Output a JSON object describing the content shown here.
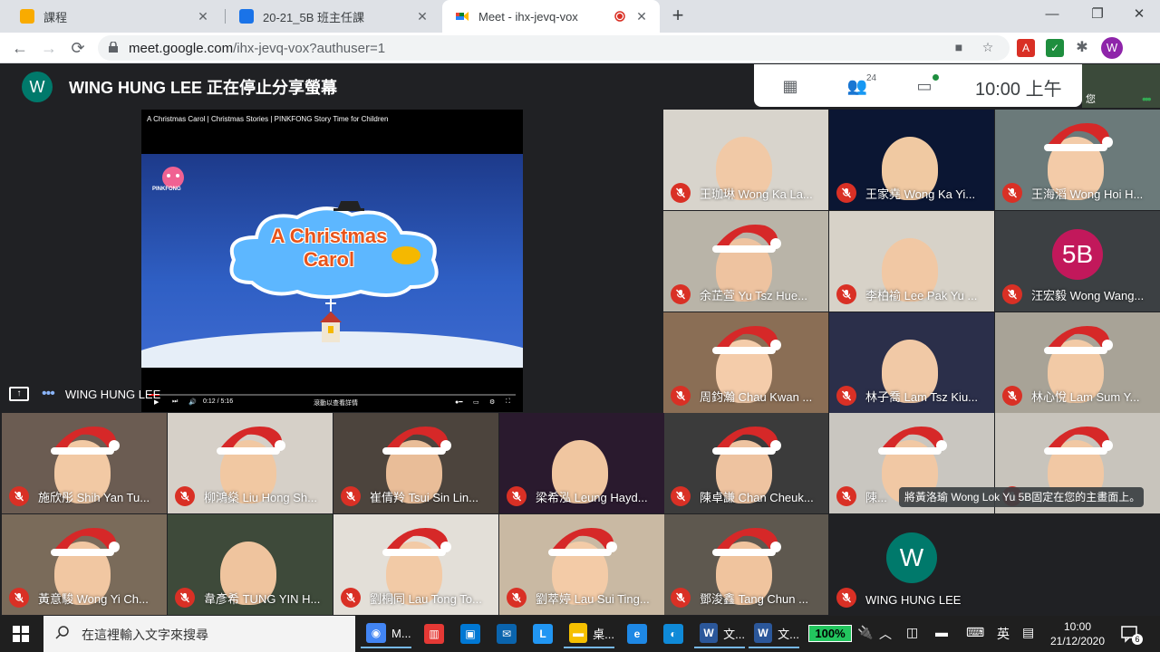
{
  "browser": {
    "tabs": [
      {
        "label": "課程",
        "color": "#f9ab00"
      },
      {
        "label": "20-21_5B 班主任課",
        "color": "#1a73e8"
      },
      {
        "label": "Meet - ihx-jevq-vox",
        "color": "#00832d"
      }
    ],
    "url_host": "meet.google.com",
    "url_path": "/ihx-jevq-vox?authuser=1",
    "profile_initial": "W"
  },
  "meet": {
    "presenter_initial": "W",
    "presenter_status": "WING HUNG LEE 正在停止分享螢幕",
    "people_count": "24",
    "clock": "10:00 上午",
    "corner_text": "您",
    "share_title": "A Christmas Carol | Christmas Stories | PINKFONG Story Time for Children",
    "video_title": "A Christmas Carol",
    "video_logo": "PINKFONG",
    "video_time": "0:12 / 5:16",
    "video_caption": "滾動以查看詳情",
    "share_name": "WING HUNG LEE",
    "pin_toast": "將黃洛瑜 Wong Lok Yu 5B固定在您的主畫面上。",
    "right_tiles": [
      {
        "name": "王珈琳 Wong Ka La..."
      },
      {
        "name": "王家堯 Wong Ka Yi..."
      },
      {
        "name": "王海滔 Wong Hoi H..."
      },
      {
        "name": "余芷萱 Yu Tsz Hue..."
      },
      {
        "name": "李柏褕 Lee Pak Yu ..."
      },
      {
        "name": "汪宏毅 Wong Wang...",
        "avatar": "5B"
      },
      {
        "name": "周鈞瀚 Chau Kwan ..."
      },
      {
        "name": "林子喬 Lam Tsz Kiu..."
      },
      {
        "name": "林心悅 Lam Sum Y..."
      },
      {
        "name": "陳卓謙 Chan Cheuk..."
      },
      {
        "name": "陳..."
      },
      {
        "name": ""
      },
      {
        "name": "鄧浚鑫 Tang Chun ..."
      },
      {
        "name": "WING HUNG LEE",
        "avatar": "W"
      }
    ],
    "bottom_tiles": [
      {
        "name": "施欣彤 Shih Yan Tu..."
      },
      {
        "name": "柳鴻燊 Liu Hong Sh..."
      },
      {
        "name": "崔倩羚 Tsui Sin Lin..."
      },
      {
        "name": "梁希泓 Leung Hayd..."
      },
      {
        "name": "黃意駿 Wong Yi Ch..."
      },
      {
        "name": "韋彥希 TUNG YIN H..."
      },
      {
        "name": "劉桐同 Lau Tong To..."
      },
      {
        "name": "劉萃婷 Lau Sui Ting..."
      }
    ]
  },
  "taskbar": {
    "search_placeholder": "在這裡輸入文字來搜尋",
    "apps": [
      {
        "label": "M...",
        "icon": "chrome-icon"
      },
      {
        "label": "",
        "icon": "app-red-icon"
      },
      {
        "label": "",
        "icon": "store-icon"
      },
      {
        "label": "",
        "icon": "mail-icon"
      },
      {
        "label": "",
        "icon": "l-app-icon"
      },
      {
        "label": "桌...",
        "icon": "folder-icon"
      },
      {
        "label": "",
        "icon": "ie-icon"
      },
      {
        "label": "",
        "icon": "edge-icon"
      },
      {
        "label": "文...",
        "icon": "word-icon"
      },
      {
        "label": "文...",
        "icon": "word-icon"
      }
    ],
    "battery": "100%",
    "ime": "英",
    "time": "10:00",
    "date": "21/12/2020",
    "notifications": "6"
  }
}
